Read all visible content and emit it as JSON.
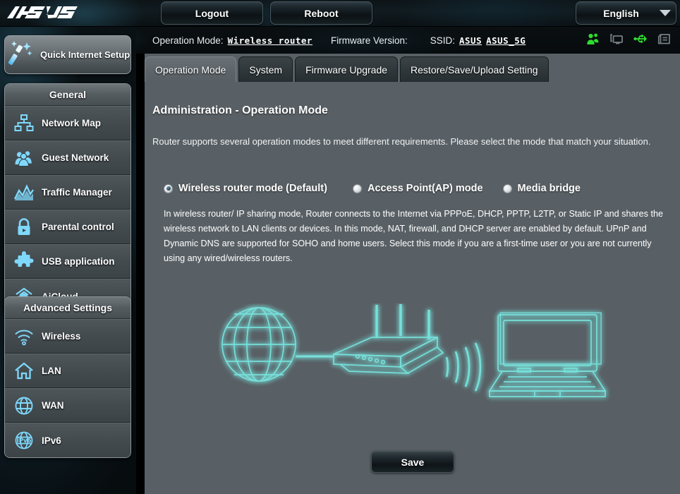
{
  "brand": {
    "logo_text": "ASUS"
  },
  "topbar": {
    "logout_label": "Logout",
    "reboot_label": "Reboot",
    "language_value": "English",
    "caret_icon": "chevron-down-icon"
  },
  "infobar": {
    "operation_mode_label": "Operation Mode:",
    "operation_mode_value": "Wireless router",
    "firmware_label": "Firmware Version:",
    "firmware_value": "",
    "ssid_label": "SSID:",
    "ssid_values": [
      "ASUS",
      "ASUS_5G"
    ],
    "icons": [
      {
        "name": "clients-users-icon",
        "color": "#2fdb2f"
      },
      {
        "name": "screens-icon",
        "color": "#6b7478"
      },
      {
        "name": "usb-icon",
        "color": "#2fdb2f"
      },
      {
        "name": "printer-icon",
        "color": "#6b7478"
      }
    ]
  },
  "sidebar": {
    "quick_setup": {
      "label": "Quick Internet Setup",
      "icon": "magic-wand-icon"
    },
    "groups": [
      {
        "title": "General",
        "items": [
          {
            "label": "Network Map",
            "icon": "network-map-icon"
          },
          {
            "label": "Guest Network",
            "icon": "guest-network-icon"
          },
          {
            "label": "Traffic Manager",
            "icon": "traffic-manager-icon"
          },
          {
            "label": "Parental control",
            "icon": "lock-icon"
          },
          {
            "label": "USB application",
            "icon": "puzzle-piece-icon"
          },
          {
            "label": "AiCloud",
            "icon": "cloud-home-icon"
          }
        ]
      },
      {
        "title": "Advanced Settings",
        "items": [
          {
            "label": "Wireless",
            "icon": "wifi-icon"
          },
          {
            "label": "LAN",
            "icon": "home-icon"
          },
          {
            "label": "WAN",
            "icon": "globe-icon"
          },
          {
            "label": "IPv6",
            "icon": "ipv6-globe-icon"
          }
        ]
      }
    ]
  },
  "main": {
    "tabs": [
      {
        "label": "Operation Mode",
        "active": true
      },
      {
        "label": "System",
        "active": false
      },
      {
        "label": "Firmware Upgrade",
        "active": false
      },
      {
        "label": "Restore/Save/Upload Setting",
        "active": false
      }
    ],
    "page_title": "Administration - Operation Mode",
    "page_desc": "Router supports several operation modes to meet different requirements. Please select the mode that match your situation.",
    "modes": [
      {
        "label": "Wireless router mode (Default)",
        "selected": true
      },
      {
        "label": "Access Point(AP) mode",
        "selected": false
      },
      {
        "label": "Media bridge",
        "selected": false
      }
    ],
    "mode_description": "In wireless router/ IP sharing mode, Router connects to the Internet via PPPoE, DHCP, PPTP, L2TP, or Static IP and shares the wireless network to LAN clients or devices. In this mode, NAT, firewall, and DHCP server are enabled by default. UPnP and Dynamic DNS are supported for SOHO and home users. Select this mode if you are a first-time user or you are not currently using any wired/wireless routers.",
    "diagram": {
      "name": "wireless-router-topology-diagram",
      "nodes": [
        "globe-internet-icon",
        "router-icon",
        "wifi-waves-icon",
        "laptop-icon"
      ]
    },
    "save_label": "Save"
  },
  "colors": {
    "accent_cyan": "#6fe7e2",
    "content_bg": "#596065",
    "sidebar_item_bg": "#464e52",
    "status_green": "#2fdb2f"
  }
}
